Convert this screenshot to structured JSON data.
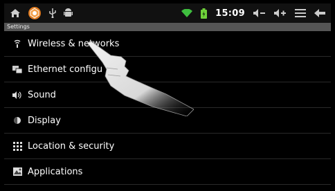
{
  "status_bar": {
    "time": "15:09",
    "icons": [
      "home-icon",
      "notification-icon",
      "usb-icon",
      "android-debug-icon",
      "wifi-icon",
      "battery-icon",
      "volume-down-icon",
      "volume-up-icon",
      "menu-icon",
      "back-icon"
    ]
  },
  "header": {
    "title": "Settings"
  },
  "settings": {
    "items": [
      {
        "label": "Wireless & networks",
        "icon": "wifi-icon"
      },
      {
        "label": "Ethernet configu",
        "icon": "ethernet-icon"
      },
      {
        "label": "Sound",
        "icon": "speaker-icon"
      },
      {
        "label": "Display",
        "icon": "display-icon"
      },
      {
        "label": "Location & security",
        "icon": "location-grid-icon"
      },
      {
        "label": "Applications",
        "icon": "applications-icon"
      }
    ]
  },
  "colors": {
    "background": "#000000",
    "status_bar": "#111111",
    "title_bar": "#555555",
    "divider": "#2a2a2a",
    "wifi": "#3fbf3f",
    "battery": "#6fd13a",
    "notification": "#e07a1e"
  }
}
